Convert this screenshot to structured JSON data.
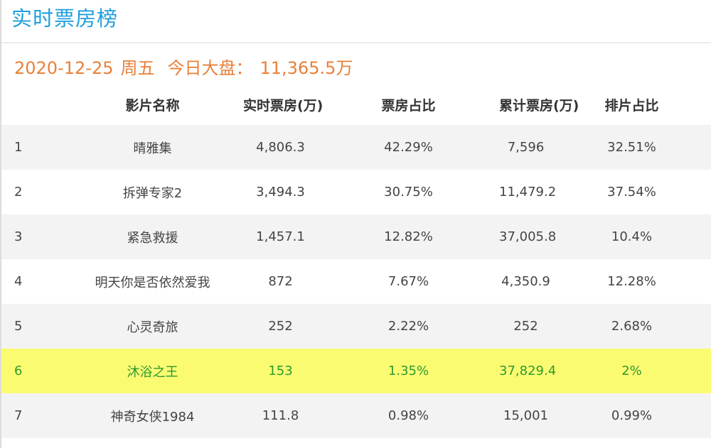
{
  "page": {
    "title": "实时票房榜",
    "date": "2020-12-25",
    "weekday": "周五",
    "market_label": "今日大盘：",
    "market_value": "11,365.5万"
  },
  "colors": {
    "title": "#1e9fdc",
    "summary": "#e8803a",
    "highlight_bg": "#fbfb72",
    "highlight_text": "#2e9a2e"
  },
  "table": {
    "headers": {
      "rank": "",
      "name": "影片名称",
      "realtime": "实时票房(万)",
      "share": "票房占比",
      "cumulative": "累计票房(万)",
      "schedule": "排片占比"
    },
    "rows": [
      {
        "rank": "1",
        "name": "晴雅集",
        "realtime": "4,806.3",
        "share": "42.29%",
        "cumulative": "7,596",
        "schedule": "32.51%"
      },
      {
        "rank": "2",
        "name": "拆弹专家2",
        "realtime": "3,494.3",
        "share": "30.75%",
        "cumulative": "11,479.2",
        "schedule": "37.54%"
      },
      {
        "rank": "3",
        "name": "紧急救援",
        "realtime": "1,457.1",
        "share": "12.82%",
        "cumulative": "37,005.8",
        "schedule": "10.4%"
      },
      {
        "rank": "4",
        "name": "明天你是否依然爱我",
        "realtime": "872",
        "share": "7.67%",
        "cumulative": "4,350.9",
        "schedule": "12.28%"
      },
      {
        "rank": "5",
        "name": "心灵奇旅",
        "realtime": "252",
        "share": "2.22%",
        "cumulative": "252",
        "schedule": "2.68%"
      },
      {
        "rank": "6",
        "name": "沐浴之王",
        "realtime": "153",
        "share": "1.35%",
        "cumulative": "37,829.4",
        "schedule": "2%"
      },
      {
        "rank": "7",
        "name": "神奇女侠1984",
        "realtime": "111.8",
        "share": "0.98%",
        "cumulative": "15,001",
        "schedule": "0.99%"
      }
    ]
  }
}
